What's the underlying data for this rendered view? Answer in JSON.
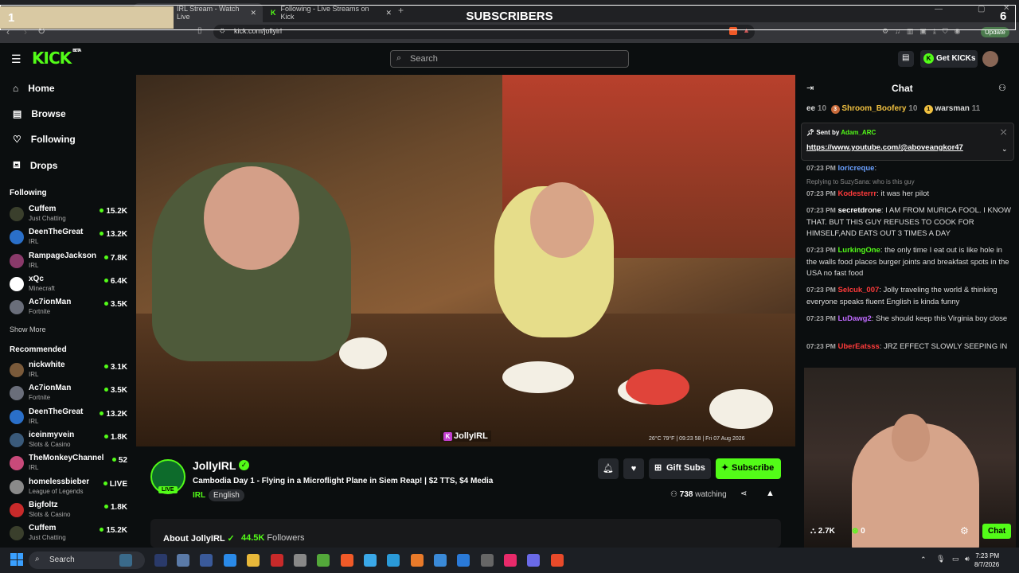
{
  "overlay": {
    "left_value": "1",
    "title": "SUBSCRIBERS",
    "right_value": "6"
  },
  "browser": {
    "tabs": [
      {
        "label": "IRL Stream - Watch Live"
      },
      {
        "label": "Following - Live Streams on Kick"
      }
    ],
    "url": "kick.com/jollyirl",
    "update_label": "Update"
  },
  "kick": {
    "logo": "KICK",
    "logo_sup": "BETA",
    "search_placeholder": "Search",
    "get_kicks": "Get KICKs"
  },
  "sidebar": {
    "nav": [
      {
        "label": "Home",
        "icon": "home-icon"
      },
      {
        "label": "Browse",
        "icon": "browse-icon"
      },
      {
        "label": "Following",
        "icon": "heart-icon"
      },
      {
        "label": "Drops",
        "icon": "drops-icon"
      }
    ],
    "following_label": "Following",
    "following": [
      {
        "name": "Cuffem",
        "category": "Just Chatting",
        "viewers": "15.2K",
        "color": "#3a3f2c"
      },
      {
        "name": "DeenTheGreat",
        "category": "IRL",
        "viewers": "13.2K",
        "color": "#2a6fc8"
      },
      {
        "name": "RampageJackson",
        "category": "IRL",
        "viewers": "7.8K",
        "color": "#8a3a6a"
      },
      {
        "name": "xQc",
        "category": "Minecraft",
        "viewers": "6.4K",
        "color": "#ffffff"
      },
      {
        "name": "Ac7ionMan",
        "category": "Fortnite",
        "viewers": "3.5K",
        "color": "#6a6e7a"
      }
    ],
    "show_more": "Show More",
    "recommended_label": "Recommended",
    "recommended": [
      {
        "name": "nickwhite",
        "category": "IRL",
        "viewers": "3.1K",
        "color": "#7a5a3a"
      },
      {
        "name": "Ac7ionMan",
        "category": "Fortnite",
        "viewers": "3.5K",
        "color": "#6a6e7a"
      },
      {
        "name": "DeenTheGreat",
        "category": "IRL",
        "viewers": "13.2K",
        "color": "#2a6fc8"
      },
      {
        "name": "iceinmyvein",
        "category": "Slots & Casino",
        "viewers": "1.8K",
        "color": "#3a5a7a"
      },
      {
        "name": "TheMonkeyChannel",
        "category": "IRL",
        "viewers": "52",
        "color": "#c84a7a"
      },
      {
        "name": "homelessbieber",
        "category": "League of Legends",
        "viewers": "LIVE",
        "color": "#8a8a8a"
      },
      {
        "name": "Bigfoltz",
        "category": "Slots & Casino",
        "viewers": "1.8K",
        "color": "#c82a2a"
      },
      {
        "name": "Cuffem",
        "category": "Just Chatting",
        "viewers": "15.2K",
        "color": "#3a3f2c"
      }
    ]
  },
  "video": {
    "tag": "JollyIRL",
    "info": "26°C  79°F  |  09:23 58  |  Fri 07 Aug 2026"
  },
  "channel": {
    "name": "JollyIRL",
    "live_badge": "LIVE",
    "title": "Cambodia Day 1 - Flying in a Microflight Plane in Siem Reap! | $2 TTS, $4 Media",
    "category": "IRL",
    "language": "English",
    "gift_subs": "Gift Subs",
    "subscribe": "Subscribe",
    "watching_count": "738",
    "watching_label": "watching",
    "about_label": "About JollyIRL",
    "followers_count": "44.5K",
    "followers_label": "Followers"
  },
  "chat": {
    "title": "Chat",
    "leaderboard": [
      {
        "rank": "",
        "name": "ee",
        "count": "10"
      },
      {
        "rank": "3",
        "name": "Shroom_Boofery",
        "count": "10"
      },
      {
        "rank": "1",
        "name": "warsman",
        "count": "11"
      }
    ],
    "pinned": {
      "sent_by_label": "Sent by",
      "user": "Adam_ARC",
      "link": "https://www.youtube.com/@aboveangkor47"
    },
    "messages": [
      {
        "time": "07:23 PM",
        "user": "loricreque",
        "color": "#6aa0ff",
        "text": ""
      },
      {
        "reply": "Replying to SuzySana: who is this guy"
      },
      {
        "time": "07:23 PM",
        "user": "Kodesterrr",
        "color": "#ff3b3b",
        "text": "it was her pilot"
      },
      {
        "time": "07:23 PM",
        "user": "secretdrone",
        "color": "#ffffff",
        "text": "I AM FROM MURICA FOOL. I KNOW THAT. BUT THIS GUY REFUSES TO COOK FOR HIMSELF,AND EATS OUT 3 TIMES A DAY"
      },
      {
        "time": "07:23 PM",
        "user": "LurkingOne",
        "color": "#53fc18",
        "text": "the only time I eat out is like hole in the walls food places burger joints and breakfast spots in the USA no fast food"
      },
      {
        "time": "07:23 PM",
        "user": "Selcuk_007",
        "color": "#ff3b3b",
        "text": "Jolly traveling the world & thinking everyone speaks fluent English is kinda funny"
      },
      {
        "time": "07:23 PM",
        "user": "LuDawg2",
        "color": "#c06bff",
        "text": "She should keep this Virginia boy close"
      },
      {
        "time": "07:23 PM",
        "user": "UberEatsss",
        "color": "#ff3b3b",
        "text": "JRZ EFFECT SLOWLY SEEPING IN"
      }
    ],
    "points": "2.7K",
    "kicks": "0",
    "chat_button": "Chat"
  },
  "taskbar": {
    "search": "Search",
    "time": "7:23 PM",
    "date": "8/7/2026"
  }
}
